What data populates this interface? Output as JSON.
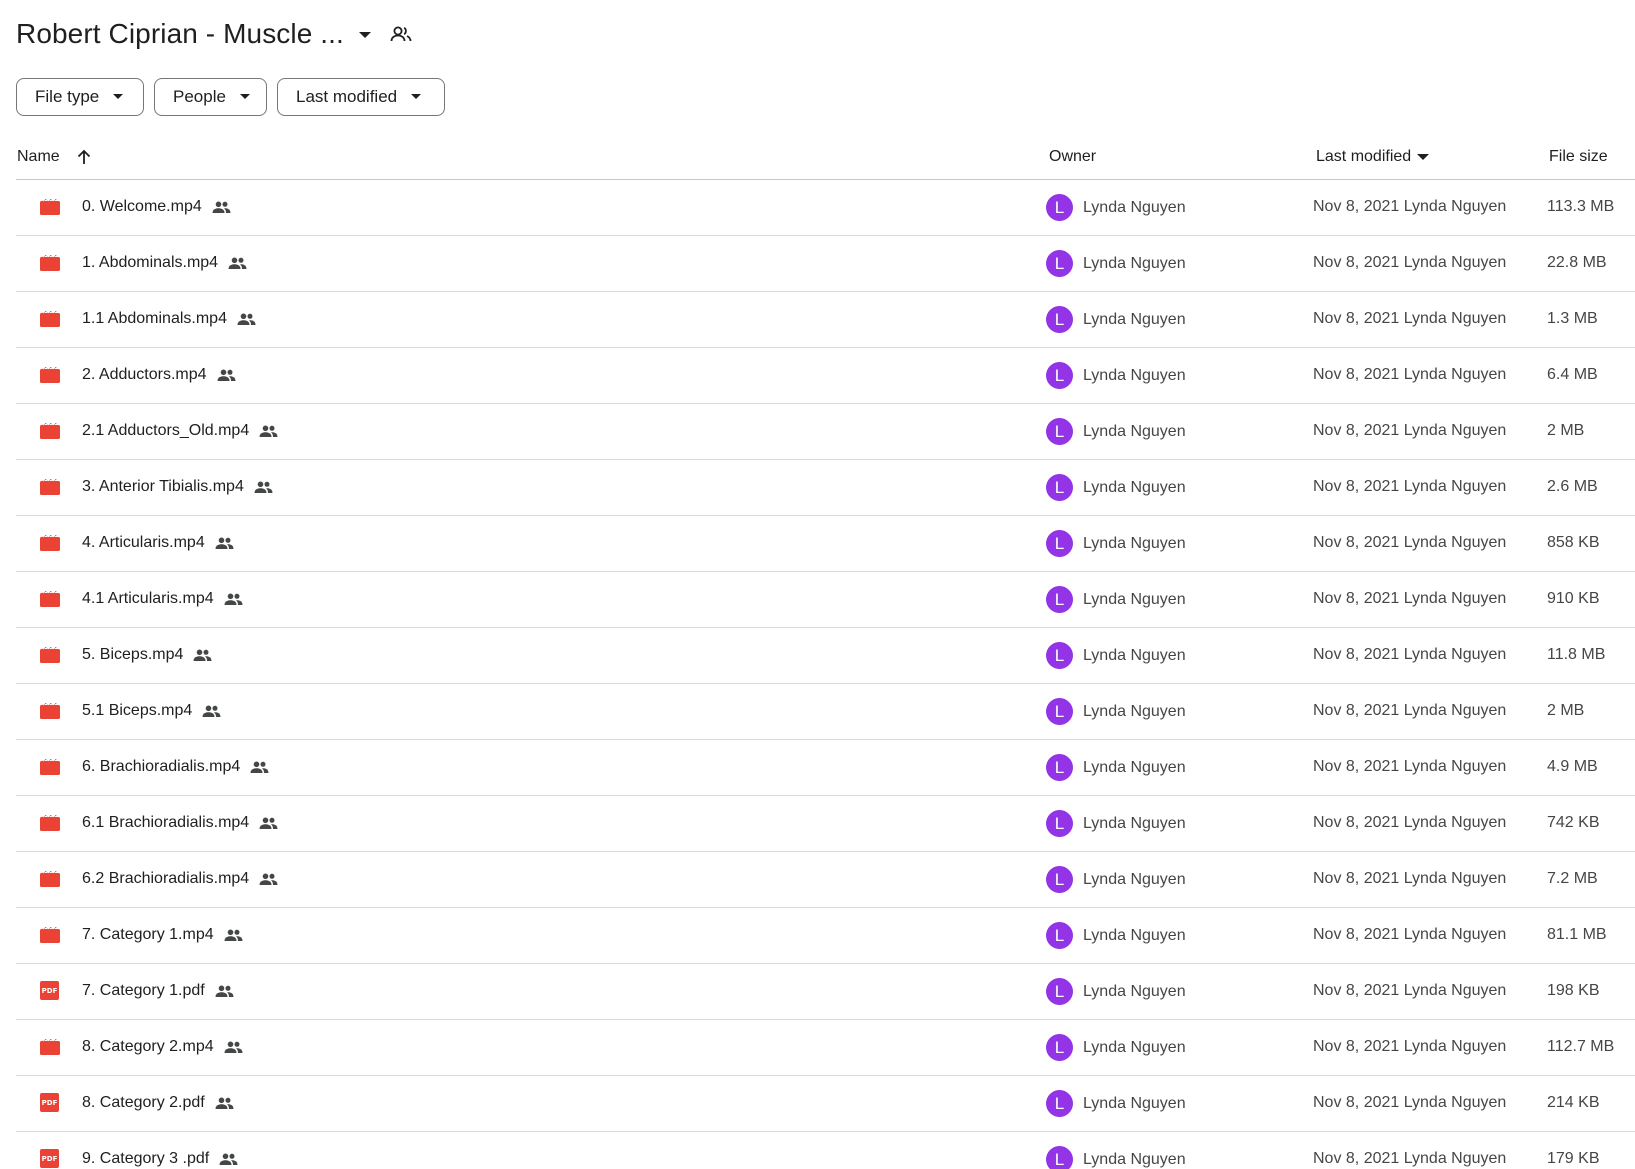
{
  "folder": {
    "title": "Robert Ciprian - Muscle ...",
    "caret_icon": "arrow-drop-down-icon",
    "shared_icon": "shared-people-icon"
  },
  "filters": [
    {
      "label": "File type"
    },
    {
      "label": "People"
    },
    {
      "label": "Last modified"
    }
  ],
  "columns": {
    "name": "Name",
    "owner": "Owner",
    "last_modified": "Last modified",
    "file_size": "File size"
  },
  "colors": {
    "video_icon": "#ea4335",
    "pdf_icon": "#ea4335",
    "avatar_bg": "#9334e6"
  },
  "files": [
    {
      "name": "0. Welcome.mp4",
      "type": "video",
      "owner_initial": "L",
      "owner": "Lynda Nguyen",
      "modified": "Nov 8, 2021 Lynda Nguyen",
      "size": "113.3 MB"
    },
    {
      "name": "1. Abdominals.mp4",
      "type": "video",
      "owner_initial": "L",
      "owner": "Lynda Nguyen",
      "modified": "Nov 8, 2021 Lynda Nguyen",
      "size": "22.8 MB"
    },
    {
      "name": "1.1 Abdominals.mp4",
      "type": "video",
      "owner_initial": "L",
      "owner": "Lynda Nguyen",
      "modified": "Nov 8, 2021 Lynda Nguyen",
      "size": "1.3 MB"
    },
    {
      "name": "2. Adductors.mp4",
      "type": "video",
      "owner_initial": "L",
      "owner": "Lynda Nguyen",
      "modified": "Nov 8, 2021 Lynda Nguyen",
      "size": "6.4 MB"
    },
    {
      "name": "2.1 Adductors_Old.mp4",
      "type": "video",
      "owner_initial": "L",
      "owner": "Lynda Nguyen",
      "modified": "Nov 8, 2021 Lynda Nguyen",
      "size": "2 MB"
    },
    {
      "name": "3. Anterior Tibialis.mp4",
      "type": "video",
      "owner_initial": "L",
      "owner": "Lynda Nguyen",
      "modified": "Nov 8, 2021 Lynda Nguyen",
      "size": "2.6 MB"
    },
    {
      "name": "4. Articularis.mp4",
      "type": "video",
      "owner_initial": "L",
      "owner": "Lynda Nguyen",
      "modified": "Nov 8, 2021 Lynda Nguyen",
      "size": "858 KB"
    },
    {
      "name": "4.1 Articularis.mp4",
      "type": "video",
      "owner_initial": "L",
      "owner": "Lynda Nguyen",
      "modified": "Nov 8, 2021 Lynda Nguyen",
      "size": "910 KB"
    },
    {
      "name": "5. Biceps.mp4",
      "type": "video",
      "owner_initial": "L",
      "owner": "Lynda Nguyen",
      "modified": "Nov 8, 2021 Lynda Nguyen",
      "size": "11.8 MB"
    },
    {
      "name": "5.1 Biceps.mp4",
      "type": "video",
      "owner_initial": "L",
      "owner": "Lynda Nguyen",
      "modified": "Nov 8, 2021 Lynda Nguyen",
      "size": "2 MB"
    },
    {
      "name": "6. Brachioradialis.mp4",
      "type": "video",
      "owner_initial": "L",
      "owner": "Lynda Nguyen",
      "modified": "Nov 8, 2021 Lynda Nguyen",
      "size": "4.9 MB"
    },
    {
      "name": "6.1 Brachioradialis.mp4",
      "type": "video",
      "owner_initial": "L",
      "owner": "Lynda Nguyen",
      "modified": "Nov 8, 2021 Lynda Nguyen",
      "size": "742 KB"
    },
    {
      "name": "6.2 Brachioradialis.mp4",
      "type": "video",
      "owner_initial": "L",
      "owner": "Lynda Nguyen",
      "modified": "Nov 8, 2021 Lynda Nguyen",
      "size": "7.2 MB"
    },
    {
      "name": "7. Category 1.mp4",
      "type": "video",
      "owner_initial": "L",
      "owner": "Lynda Nguyen",
      "modified": "Nov 8, 2021 Lynda Nguyen",
      "size": "81.1 MB"
    },
    {
      "name": "7. Category 1.pdf",
      "type": "pdf",
      "owner_initial": "L",
      "owner": "Lynda Nguyen",
      "modified": "Nov 8, 2021 Lynda Nguyen",
      "size": "198 KB"
    },
    {
      "name": "8. Category 2.mp4",
      "type": "video",
      "owner_initial": "L",
      "owner": "Lynda Nguyen",
      "modified": "Nov 8, 2021 Lynda Nguyen",
      "size": "112.7 MB"
    },
    {
      "name": "8. Category 2.pdf",
      "type": "pdf",
      "owner_initial": "L",
      "owner": "Lynda Nguyen",
      "modified": "Nov 8, 2021 Lynda Nguyen",
      "size": "214 KB"
    },
    {
      "name": "9. Category 3 .pdf",
      "type": "pdf",
      "owner_initial": "L",
      "owner": "Lynda Nguyen",
      "modified": "Nov 8, 2021 Lynda Nguyen",
      "size": "179 KB"
    }
  ],
  "pdf_icon_text": "PDF"
}
